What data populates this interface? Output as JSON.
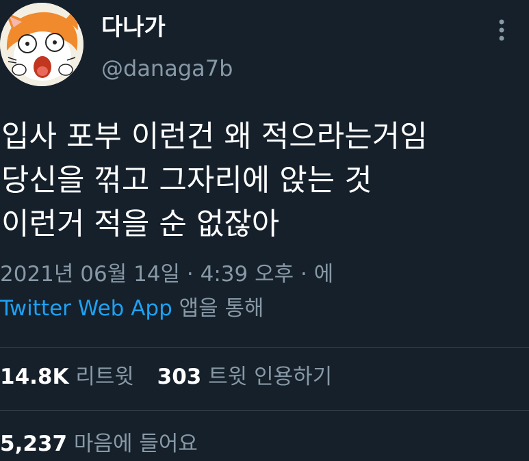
{
  "user": {
    "display_name": "다나가",
    "handle": "@danaga7b",
    "avatar_icon": "hamster-avatar-icon"
  },
  "tweet": {
    "lines": [
      "입사 포부 이런건 왜 적으라는거임",
      "당신을 꺾고 그자리에 앉는 것",
      "이런거 적을 순 없잖아"
    ]
  },
  "meta": {
    "date": "2021년 06월 14일",
    "separator": "·",
    "time": "4:39 오후",
    "via_prefix": "에",
    "source": "Twitter Web App",
    "via_suffix": "앱을 통해"
  },
  "stats": {
    "retweets_count": "14.8K",
    "retweets_label": "리트윗",
    "quotes_count": "303",
    "quotes_label": "트윗 인용하기",
    "likes_count": "5,237",
    "likes_label": "마음에 들어요"
  },
  "icons": {
    "more": "more-vertical-icon"
  },
  "colors": {
    "background": "#15202b",
    "text": "#ffffff",
    "secondary": "#8899a6",
    "link": "#1da1f2",
    "divider": "#38444d"
  }
}
